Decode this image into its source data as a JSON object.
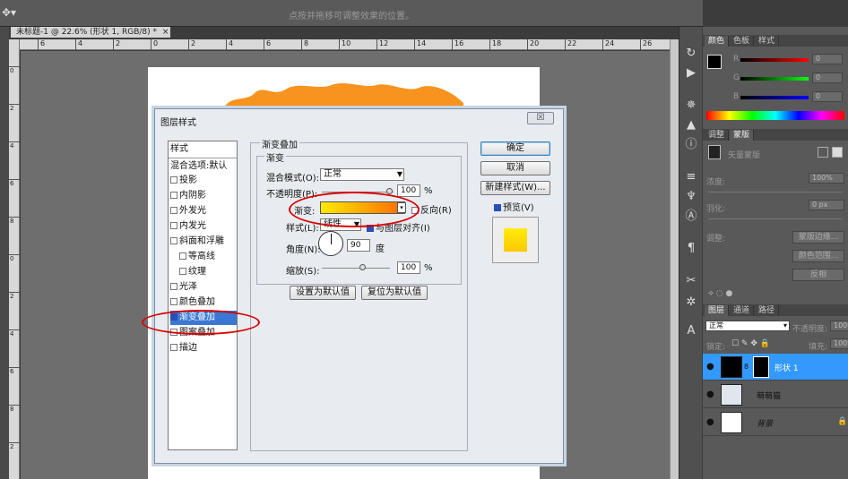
{
  "optbar": {
    "tool_icon": "move-tool-icon",
    "hint": "点按并拖移可调整效果的位置。"
  },
  "doc_tab": {
    "title": "未标题-1 @ 22.6% (形状 1, RGB/8) *",
    "close": "×"
  },
  "ruler": {
    "h_ticks": [
      "6",
      "4",
      "2",
      "0",
      "2",
      "4",
      "6",
      "8",
      "10",
      "12",
      "14",
      "16",
      "18",
      "20",
      "22",
      "24",
      "26"
    ],
    "v_ticks": [
      "0",
      "2",
      "4",
      "6",
      "8",
      "0",
      "2",
      "4",
      "6",
      "8",
      "2"
    ]
  },
  "dialog": {
    "title": "图层样式",
    "close": "☒",
    "styles_header": "样式",
    "blend_default": "混合选项:默认",
    "styles": [
      {
        "label": "投影",
        "checked": false,
        "indent": false
      },
      {
        "label": "内阴影",
        "checked": false,
        "indent": false
      },
      {
        "label": "外发光",
        "checked": false,
        "indent": false
      },
      {
        "label": "内发光",
        "checked": false,
        "indent": false
      },
      {
        "label": "斜面和浮雕",
        "checked": false,
        "indent": false
      },
      {
        "label": "等高线",
        "checked": false,
        "indent": true
      },
      {
        "label": "纹理",
        "checked": false,
        "indent": true
      },
      {
        "label": "光泽",
        "checked": false,
        "indent": false
      },
      {
        "label": "颜色叠加",
        "checked": false,
        "indent": false
      },
      {
        "label": "渐变叠加",
        "checked": true,
        "indent": false,
        "selected": true
      },
      {
        "label": "图案叠加",
        "checked": false,
        "indent": false
      },
      {
        "label": "描边",
        "checked": false,
        "indent": false
      }
    ],
    "group_title": "渐变叠加",
    "sub_title": "渐变",
    "blend_mode_label": "混合模式(O):",
    "blend_mode_value": "正常",
    "opacity_label": "不透明度(P):",
    "opacity_value": "100",
    "opacity_unit": "%",
    "gradient_label": "渐变:",
    "reverse_label": "反向(R)",
    "style_label": "样式(L):",
    "style_value": "线性",
    "align_label": "与图层对齐(I)",
    "angle_label": "角度(N):",
    "angle_value": "90",
    "angle_unit": "度",
    "scale_label": "缩放(S):",
    "scale_value": "100",
    "scale_unit": "%",
    "set_default": "设置为默认值",
    "reset_default": "复位为默认值",
    "ok": "确定",
    "cancel": "取消",
    "new_style": "新建样式(W)...",
    "preview": "预览(V)"
  },
  "color_panel": {
    "tabs": [
      "颜色",
      "色板",
      "样式"
    ],
    "r_label": "R",
    "g_label": "G",
    "b_label": "B",
    "r_value": "0",
    "g_value": "0",
    "b_value": "0"
  },
  "mask_panel": {
    "tabs": [
      "调整",
      "蒙版"
    ],
    "title": "矢量蒙版",
    "density_label": "浓度:",
    "density_value": "100%",
    "feather_label": "羽化:",
    "feather_value": "0 px",
    "refine_label": "调整:",
    "btn_edge": "蒙版边缘...",
    "btn_color_range": "颜色范围...",
    "btn_invert": "反相"
  },
  "layers_panel": {
    "tabs": [
      "图层",
      "通道",
      "路径"
    ],
    "blend_value": "正常",
    "opacity_label": "不透明度:",
    "opacity_value": "100%",
    "lock_label": "锁定:",
    "fill_label": "填充:",
    "fill_value": "100%",
    "layers": [
      {
        "name": "形状 1",
        "selected": true
      },
      {
        "name": "萌萌猫",
        "selected": false
      },
      {
        "name": "背景",
        "selected": false
      }
    ]
  },
  "colors": {
    "accent_selection": "#3a78d4",
    "annotation_red": "#d80000",
    "gradient_start": "#ffea00",
    "gradient_end": "#ff6a00",
    "shape_orange": "#f7931e"
  }
}
